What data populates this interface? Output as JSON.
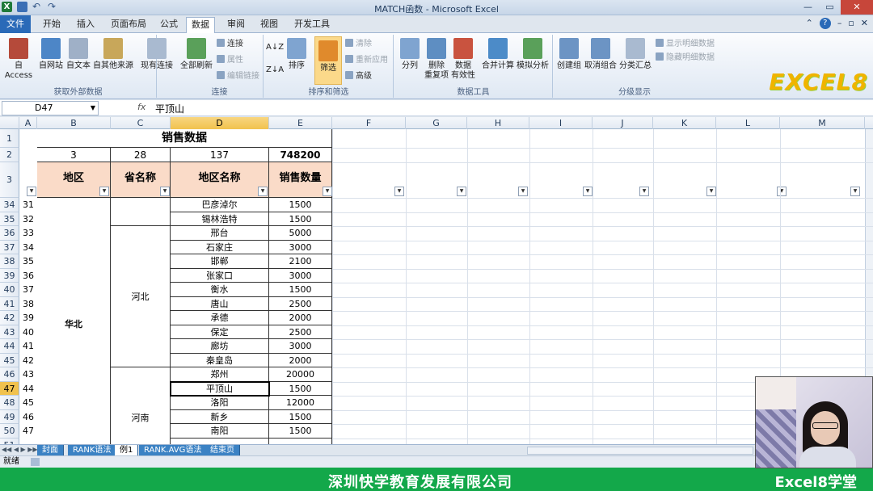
{
  "window": {
    "title": "MATCH函数 - Microsoft Excel"
  },
  "tabs": {
    "file": "文件",
    "items": [
      "开始",
      "插入",
      "页面布局",
      "公式",
      "数据",
      "审阅",
      "视图",
      "开发工具"
    ],
    "active": "数据"
  },
  "ribbon": {
    "external": {
      "access": "自 Access",
      "web": "自网站",
      "text": "自文本",
      "other": "自其他来源",
      "existing": "现有连接",
      "label": "获取外部数据"
    },
    "connections": {
      "refresh": "全部刷新",
      "connect": "连接",
      "properties": "属性",
      "edit_links": "编辑链接",
      "label": "连接"
    },
    "sort": {
      "sort": "排序",
      "filter": "筛选",
      "clear": "清除",
      "reapply": "重新应用",
      "advanced": "高级",
      "label": "排序和筛选"
    },
    "tools": {
      "split": "分列",
      "dedupe": "删除\n重复项",
      "validate": "数据\n有效性",
      "consolidate": "合并计算",
      "whatif": "模拟分析",
      "label": "数据工具"
    },
    "outline": {
      "group": "创建组",
      "ungroup": "取消组合",
      "subtotal": "分类汇总",
      "show": "显示明细数据",
      "hide": "隐藏明细数据",
      "label": "分级显示"
    }
  },
  "logo": "EXCEL8",
  "formula_bar": {
    "name_box": "D47",
    "fx": "fx",
    "formula": "平顶山"
  },
  "columns": [
    "A",
    "B",
    "C",
    "D",
    "E",
    "F",
    "G",
    "H",
    "I",
    "J",
    "K",
    "L",
    "M"
  ],
  "sheet": {
    "title": "销售数据",
    "counts": [
      "3",
      "28",
      "137",
      "748200"
    ],
    "headers": [
      "地区",
      "省名称",
      "地区名称",
      "销售数量"
    ],
    "region": "华北",
    "provinces": [
      "河北",
      "河南"
    ],
    "rows": [
      {
        "row": "34",
        "a": "31",
        "city": "巴彦淖尔",
        "qty": "1500"
      },
      {
        "row": "35",
        "a": "32",
        "city": "锡林浩特",
        "qty": "1500"
      },
      {
        "row": "36",
        "a": "33",
        "city": "邢台",
        "qty": "5000"
      },
      {
        "row": "37",
        "a": "34",
        "city": "石家庄",
        "qty": "3000"
      },
      {
        "row": "38",
        "a": "35",
        "city": "邯郸",
        "qty": "2100"
      },
      {
        "row": "39",
        "a": "36",
        "city": "张家口",
        "qty": "3000"
      },
      {
        "row": "40",
        "a": "37",
        "city": "衡水",
        "qty": "1500"
      },
      {
        "row": "41",
        "a": "38",
        "city": "唐山",
        "qty": "2500"
      },
      {
        "row": "42",
        "a": "39",
        "city": "承德",
        "qty": "2000"
      },
      {
        "row": "43",
        "a": "40",
        "city": "保定",
        "qty": "2500"
      },
      {
        "row": "44",
        "a": "41",
        "city": "廊坊",
        "qty": "3000"
      },
      {
        "row": "45",
        "a": "42",
        "city": "秦皇岛",
        "qty": "2000"
      },
      {
        "row": "46",
        "a": "43",
        "city": "郑州",
        "qty": "20000"
      },
      {
        "row": "47",
        "a": "44",
        "city": "平顶山",
        "qty": "1500"
      },
      {
        "row": "48",
        "a": "45",
        "city": "洛阳",
        "qty": "12000"
      },
      {
        "row": "49",
        "a": "46",
        "city": "新乡",
        "qty": "1500"
      },
      {
        "row": "50",
        "a": "47",
        "city": "南阳",
        "qty": "1500"
      },
      {
        "row": "51",
        "a": "",
        "city": "",
        "qty": ""
      }
    ]
  },
  "sheet_tabs": [
    "封面",
    "RANK语法",
    "例1",
    "RANK.AVG语法",
    "结束页"
  ],
  "active_sheet": "例1",
  "status": {
    "ready": "就绪"
  },
  "footer": {
    "company": "深圳快学教育发展有限公司",
    "brand": "Excel8学堂"
  }
}
